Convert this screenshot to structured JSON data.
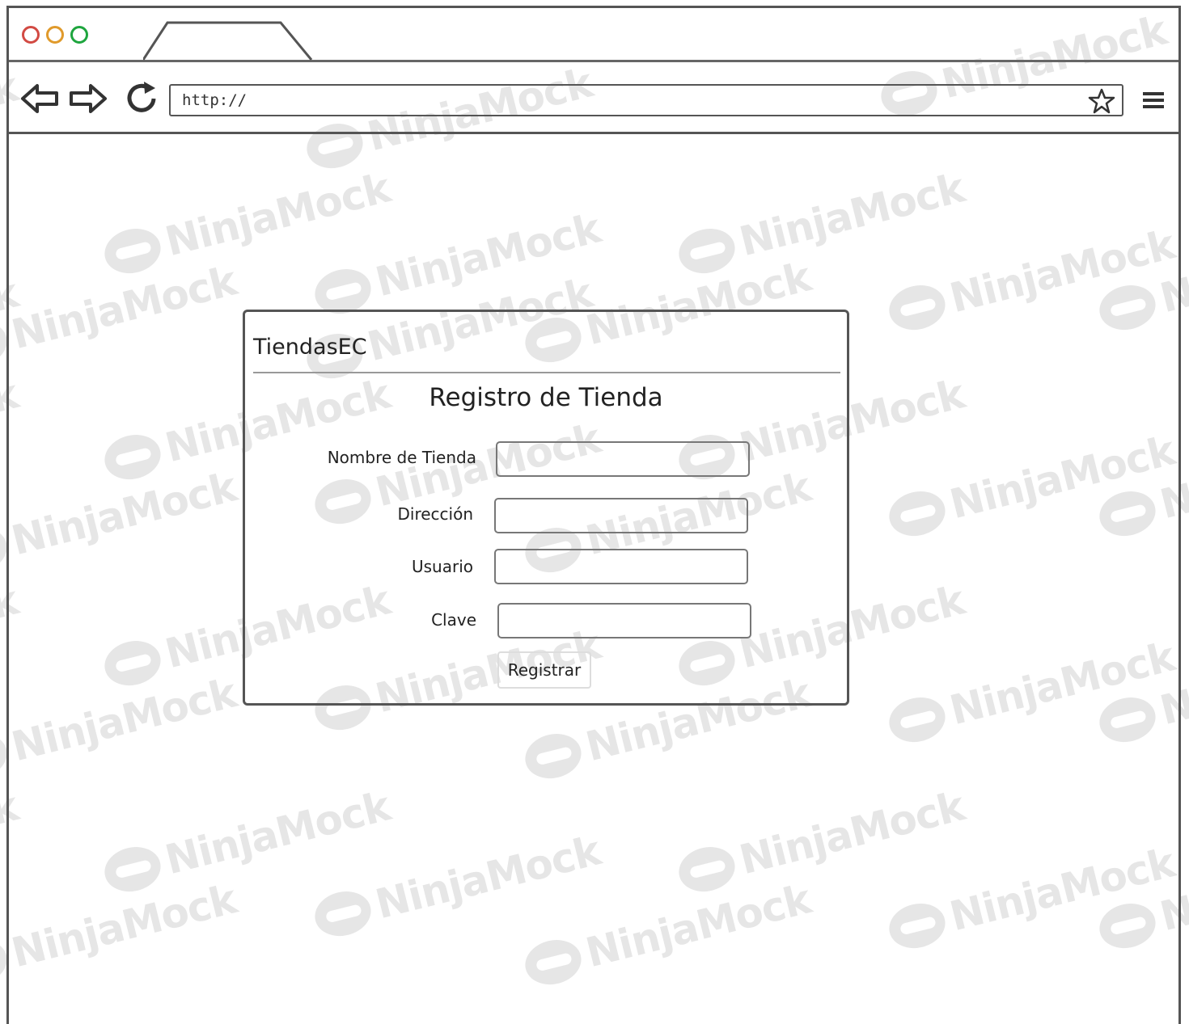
{
  "browser": {
    "url_text": "http://"
  },
  "card": {
    "brand": "TiendasEC",
    "title": "Registro de Tienda",
    "fields": [
      {
        "label": "Nombre de Tienda",
        "value": ""
      },
      {
        "label": "Dirección",
        "value": ""
      },
      {
        "label": "Usuario",
        "value": ""
      },
      {
        "label": "Clave",
        "value": ""
      }
    ],
    "submit_label": "Registrar"
  },
  "watermark": {
    "text": "NinjaMock"
  }
}
